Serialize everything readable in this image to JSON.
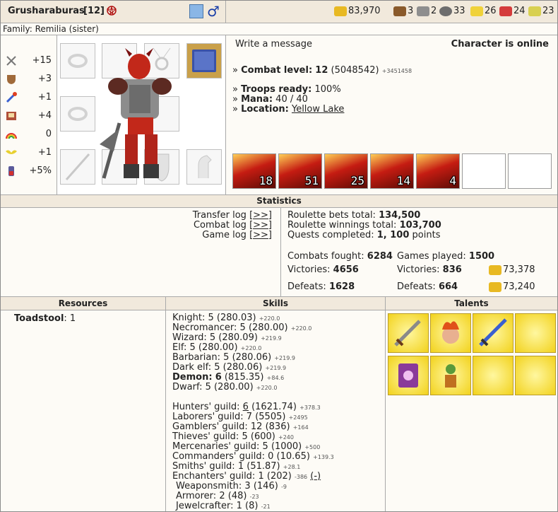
{
  "header": {
    "name": "Grusharaburas",
    "level": "[12]",
    "family": "Family: Remilia (sister)"
  },
  "resources_bar": [
    {
      "icon": "gold-icon",
      "value": "83,970"
    },
    {
      "icon": "wood-icon",
      "value": "3"
    },
    {
      "icon": "ore-icon",
      "value": "2"
    },
    {
      "icon": "mercury-icon",
      "value": "33"
    },
    {
      "icon": "sulfur-icon",
      "value": "26"
    },
    {
      "icon": "crystal-icon",
      "value": "24"
    },
    {
      "icon": "gems-icon",
      "value": "23"
    }
  ],
  "char_stats": [
    {
      "icon": "attack-icon",
      "value": "+15"
    },
    {
      "icon": "defense-icon",
      "value": "+3"
    },
    {
      "icon": "spellpower-icon",
      "value": "+1"
    },
    {
      "icon": "knowledge-icon",
      "value": "+4"
    },
    {
      "icon": "luck-icon",
      "value": "0"
    },
    {
      "icon": "morale-icon",
      "value": "+1"
    },
    {
      "icon": "initiative-icon",
      "value": "+5%"
    }
  ],
  "info": {
    "write_message": "Write a message",
    "status": "Character is online",
    "combat_label": "Combat level:",
    "combat_value": "12",
    "combat_exp": "(5048542)",
    "combat_next": "+3451458",
    "troops_label": "Troops ready:",
    "troops_value": "100%",
    "mana_label": "Mana:",
    "mana_value": "40 / 40",
    "location_label": "Location:",
    "location_value": "Yellow Lake"
  },
  "troops": [
    "18",
    "51",
    "25",
    "14",
    "4",
    "",
    ""
  ],
  "statistics": {
    "title": "Statistics",
    "transfer_log": "Transfer log",
    "combat_log": "Combat log",
    "game_log": "Game log",
    "log_link": "[>>]",
    "roulette_bets_label": "Roulette bets total:",
    "roulette_bets_value": "134,500",
    "roulette_win_label": "Roulette winnings total:",
    "roulette_win_value": "103,700",
    "quests_label": "Quests completed:",
    "quests_value": "1, 100",
    "quests_unit": "points",
    "combats_label": "Combats fought:",
    "combats_value": "6284",
    "victories_label": "Victories:",
    "victories_value": "4656",
    "defeats_label": "Defeats:",
    "defeats_value": "1628",
    "games_label": "Games played:",
    "games_value": "1500",
    "game_victories_value": "836",
    "game_defeats_value": "664",
    "games_won_gold": "73,378",
    "games_lost_gold": "73,240"
  },
  "sections": {
    "resources": "Resources",
    "skills": "Skills",
    "talents": "Talents"
  },
  "resources_list": {
    "name": "Toadstool",
    "value": ": 1"
  },
  "skills": [
    {
      "name": "Knight:",
      "level": "5",
      "value": "(280.03)",
      "delta": "+220.0"
    },
    {
      "name": "Necromancer:",
      "level": "5",
      "value": "(280.00)",
      "delta": "+220.0"
    },
    {
      "name": "Wizard:",
      "level": "5",
      "value": "(280.09)",
      "delta": "+219.9"
    },
    {
      "name": "Elf:",
      "level": "5",
      "value": "(280.00)",
      "delta": "+220.0"
    },
    {
      "name": "Barbarian:",
      "level": "5",
      "value": "(280.06)",
      "delta": "+219.9"
    },
    {
      "name": "Dark elf:",
      "level": "5",
      "value": "(280.06)",
      "delta": "+219.9"
    },
    {
      "name": "Demon:",
      "level": "6",
      "value": "(815.35)",
      "delta": "+84.6",
      "bold": true
    },
    {
      "name": "Dwarf:",
      "level": "5",
      "value": "(280.00)",
      "delta": "+220.0"
    }
  ],
  "guilds": [
    {
      "name": "Hunters' guild:",
      "level": "6",
      "value": "(1621.74)",
      "delta": "+378.3",
      "underline": true
    },
    {
      "name": "Laborers' guild:",
      "level": "7",
      "value": "(5505)",
      "delta": "+2495"
    },
    {
      "name": "Gamblers' guild:",
      "level": "12",
      "value": "(836)",
      "delta": "+164"
    },
    {
      "name": "Thieves' guild:",
      "level": "5",
      "value": "(600)",
      "delta": "+240"
    },
    {
      "name": "Mercenaries' guild:",
      "level": "5",
      "value": "(1000)",
      "delta": "+500"
    },
    {
      "name": "Commanders' guild:",
      "level": "0",
      "value": "(10.65)",
      "delta": "+139.3"
    },
    {
      "name": "Smiths' guild:",
      "level": "1",
      "value": "(51.87)",
      "delta": "+28.1"
    },
    {
      "name": "Enchanters' guild:",
      "level": "1",
      "value": "(202)",
      "delta": "-386",
      "extra": "(-)"
    },
    {
      "name": "Weaponsmith:",
      "level": "3",
      "value": "(146)",
      "delta": "-9",
      "indent": true
    },
    {
      "name": "Armorer:",
      "level": "2",
      "value": "(48)",
      "delta": "-23",
      "indent": true
    },
    {
      "name": "Jewelcrafter:",
      "level": "1",
      "value": "(8)",
      "delta": "-21",
      "indent": true
    }
  ],
  "talents": [
    {
      "icon": "sword-talent-icon"
    },
    {
      "icon": "fire-head-talent-icon"
    },
    {
      "icon": "blue-sword-talent-icon"
    },
    {
      "icon": "empty-talent-slot"
    },
    {
      "icon": "scroll-talent-icon"
    },
    {
      "icon": "goblin-talent-icon"
    },
    {
      "icon": "empty-talent-slot"
    },
    {
      "icon": "empty-talent-slot"
    }
  ],
  "colors": {
    "header_bg": "#f1e9dc",
    "border": "#a9a9a9",
    "gold": "#e8b923"
  }
}
